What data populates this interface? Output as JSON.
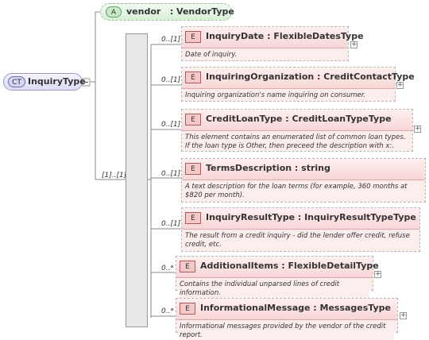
{
  "complex_type": {
    "badge": "CT",
    "name": "InquiryType"
  },
  "attribute": {
    "badge": "A",
    "name": "vendor",
    "type": ": VendorType"
  },
  "sequence": {
    "cardinality": "[1]..[1]"
  },
  "elements": [
    {
      "cardinality": "0..[1]",
      "badge": "E",
      "name": "InquiryDate : FlexibleDatesType",
      "doc": "Date of inquiry."
    },
    {
      "cardinality": "0..[1]",
      "badge": "E",
      "name": "InquiringOrganization : CreditContactType",
      "doc": "Inquiring organization's name inquiring on consumer."
    },
    {
      "cardinality": "0..[1]",
      "badge": "E",
      "name": "CreditLoanType : CreditLoanTypeType",
      "doc": "This element contains an enumerated list of common loan types. If the loan type is Other, then preceed the description with x:."
    },
    {
      "cardinality": "0..[1]",
      "badge": "E",
      "name": "TermsDescription : string",
      "doc": "A text description for the loan terms (for example, 360 months at $820 per month)."
    },
    {
      "cardinality": "0..[1]",
      "badge": "E",
      "name": "InquiryResultType : InquiryResultTypeType",
      "doc": "The result from a credit inquiry - did the lender offer credit, refuse credit, etc."
    },
    {
      "cardinality": "0..*",
      "badge": "E",
      "name": "AdditionalItems : FlexibleDetailType",
      "doc": "Contains the individual unparsed lines of credit information."
    },
    {
      "cardinality": "0..*",
      "badge": "E",
      "name": "InformationalMessage : MessagesType",
      "doc": "Informational messages provided by the vendor of the credit report."
    }
  ]
}
